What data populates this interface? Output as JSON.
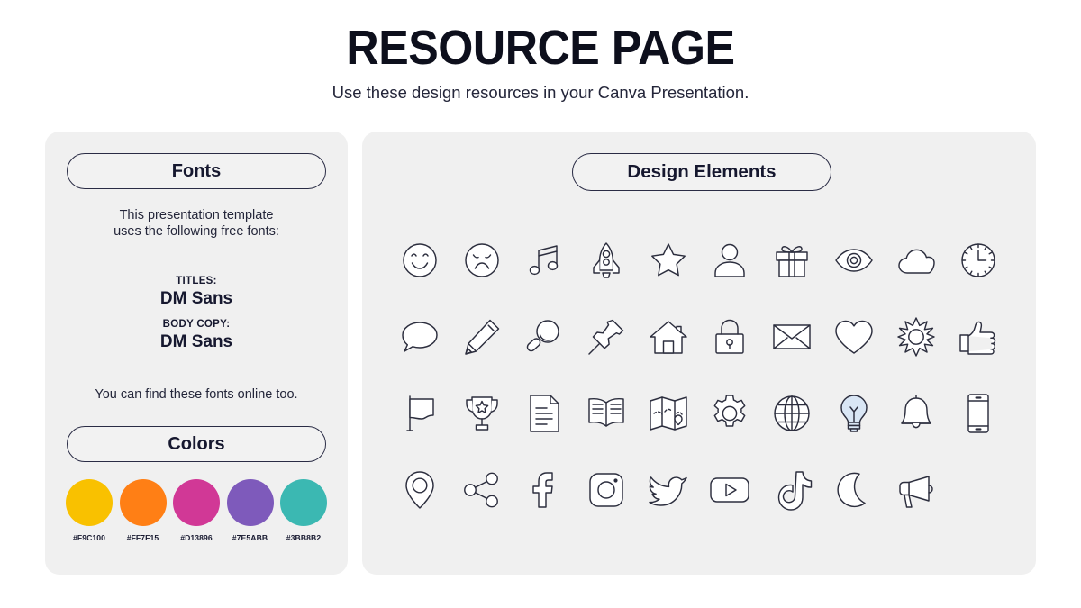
{
  "header": {
    "title": "RESOURCE PAGE",
    "subtitle": "Use these design resources in your Canva Presentation."
  },
  "fonts_panel": {
    "heading": "Fonts",
    "intro_line_1": "This presentation template",
    "intro_line_2": "uses the following free fonts:",
    "titles_label": "TITLES:",
    "titles_value": "DM Sans",
    "body_label": "BODY COPY:",
    "body_value": "DM Sans",
    "online_note": "You can find these fonts online too."
  },
  "colors_panel": {
    "heading": "Colors",
    "swatches": [
      {
        "hex_label": "#F9C100",
        "hex": "#F9C100",
        "name": "yellow"
      },
      {
        "hex_label": "#FF7F15",
        "hex": "#FF7F15",
        "name": "orange"
      },
      {
        "hex_label": "#D13896",
        "hex": "#D13896",
        "name": "magenta"
      },
      {
        "hex_label": "#7E5ABB",
        "hex": "#7E5ABB",
        "name": "purple"
      },
      {
        "hex_label": "#3BB8B2",
        "hex": "#3BB8B2",
        "name": "teal"
      }
    ]
  },
  "design_elements_panel": {
    "heading": "Design Elements",
    "icons": [
      "smiley-face-icon",
      "sad-face-icon",
      "music-note-icon",
      "rocket-icon",
      "star-icon",
      "user-icon",
      "gift-icon",
      "eye-icon",
      "cloud-icon",
      "clock-icon",
      "speech-bubble-icon",
      "pencil-icon",
      "magnifying-glass-icon",
      "push-pin-icon",
      "house-icon",
      "padlock-icon",
      "envelope-icon",
      "heart-icon",
      "sun-icon",
      "thumbs-up-icon",
      "flag-icon",
      "trophy-icon",
      "document-icon",
      "open-book-icon",
      "map-icon",
      "gear-icon",
      "globe-icon",
      "lightbulb-icon",
      "bell-icon",
      "smartphone-icon",
      "location-pin-icon",
      "share-icon",
      "facebook-icon",
      "instagram-icon",
      "twitter-icon",
      "youtube-icon",
      "tiktok-icon",
      "moon-icon",
      "megaphone-icon"
    ]
  },
  "theme": {
    "panel_background": "#F0F0F0",
    "page_background": "#FFFFFF",
    "text_color": "#16182F",
    "icon_stroke": "#2C2E3E",
    "bulb_fill": "#D9E6F5"
  }
}
